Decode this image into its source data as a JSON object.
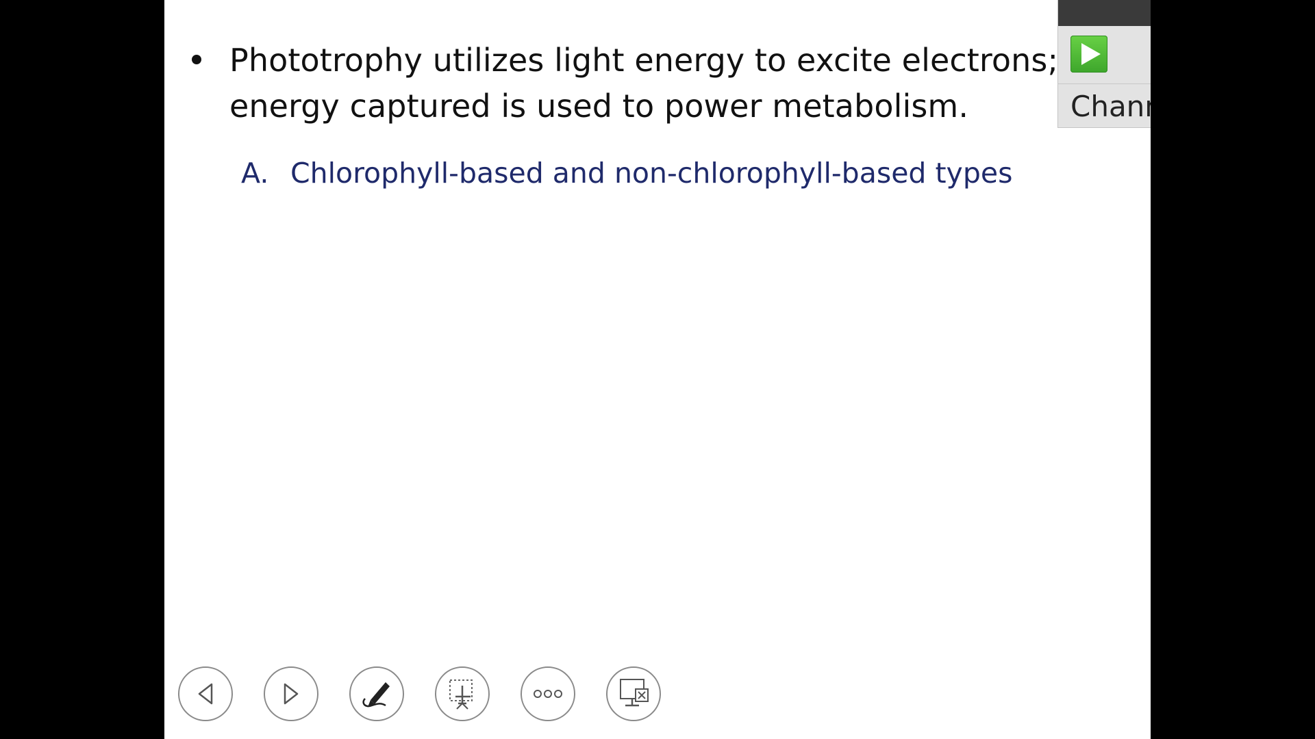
{
  "slide": {
    "bullet": {
      "line1": "Phototrophy utilizes light energy to excite electrons; t",
      "line2": "energy captured is used to power metabolism."
    },
    "subpoint": {
      "marker": "A.",
      "text": "Chlorophyll-based and non-chlorophyll-based types"
    }
  },
  "toolbar": {
    "buttons": [
      {
        "name": "previous-slide",
        "icon": "arrow-left-icon"
      },
      {
        "name": "next-slide",
        "icon": "arrow-right-icon"
      },
      {
        "name": "pen-tool",
        "icon": "pen-icon"
      },
      {
        "name": "see-all-slides",
        "icon": "slides-icon"
      },
      {
        "name": "more-options",
        "icon": "ellipsis-icon"
      },
      {
        "name": "end-show",
        "icon": "end-show-icon"
      }
    ]
  },
  "overlay": {
    "play_icon": "play-icon",
    "label": "Chann"
  },
  "colors": {
    "background": "#000000",
    "slide": "#ffffff",
    "bullet_text": "#111111",
    "subpoint_text": "#1f2a6b",
    "play_green": "#4cbb35"
  }
}
